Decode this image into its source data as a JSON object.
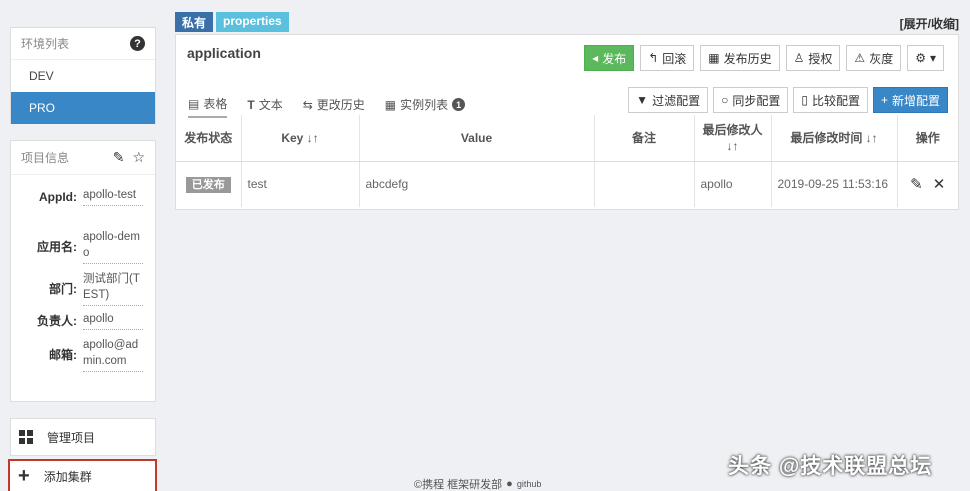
{
  "sidebar": {
    "env_title": "环境列表",
    "envs": [
      "DEV",
      "PRO"
    ],
    "info_title": "项目信息",
    "info": [
      {
        "label": "AppId:",
        "value": "apollo-test"
      },
      {
        "label": "应用名:",
        "value": "apollo-demo"
      },
      {
        "label": "部门:",
        "value": "测试部门(TEST)"
      },
      {
        "label": "负责人:",
        "value": "apollo"
      },
      {
        "label": "邮箱:",
        "value": "apollo@admin.com"
      }
    ],
    "manage_label": "管理项目",
    "add_label": "添加集群"
  },
  "namespace": {
    "tag_private": "私有",
    "tag_format": "properties",
    "toggle": "[展开/收缩]",
    "name": "application",
    "actions": {
      "publish": "发布",
      "rollback": "回滚",
      "history": "发布历史",
      "auth": "授权",
      "gray": "灰度"
    },
    "tabs": {
      "table": "表格",
      "text": "文本",
      "change_history": "更改历史",
      "instances": "实例列表",
      "instances_count": "1"
    },
    "tools": {
      "filter": "过滤配置",
      "sync": "同步配置",
      "compare": "比较配置",
      "add": "新增配置"
    },
    "columns": {
      "status": "发布状态",
      "key": "Key",
      "value": "Value",
      "comment": "备注",
      "modifier": "最后修改人",
      "modified_time": "最后修改时间",
      "ops": "操作"
    },
    "rows": [
      {
        "status": "已发布",
        "key": "test",
        "value": "abcdefg",
        "comment": "",
        "modifier": "apollo",
        "modified_time": "2019-09-25 11:53:16"
      }
    ]
  },
  "footer": {
    "text": "©携程 框架研发部",
    "github": "github"
  },
  "watermark": "头条 @技术联盟总坛",
  "colors": {
    "primary": "#3a87c8",
    "success": "#5cb85c",
    "info": "#5bc0de",
    "highlight_border": "#c0392b"
  }
}
